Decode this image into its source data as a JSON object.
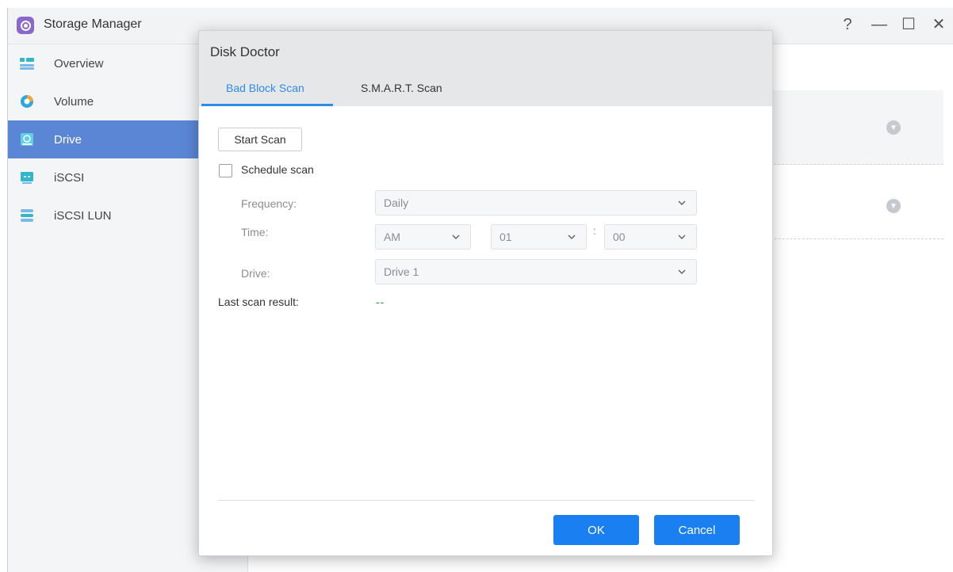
{
  "app": {
    "title": "Storage Manager",
    "window_controls": {
      "help": "?",
      "minimize": "—",
      "maximize": "☐",
      "close": "✕"
    }
  },
  "sidebar": {
    "items": [
      {
        "label": "Overview",
        "icon": "overview-icon",
        "active": false
      },
      {
        "label": "Volume",
        "icon": "volume-icon",
        "active": false
      },
      {
        "label": "Drive",
        "icon": "drive-icon",
        "active": true
      },
      {
        "label": "iSCSI",
        "icon": "iscsi-icon",
        "active": false
      },
      {
        "label": "iSCSI LUN",
        "icon": "iscsi-lun-icon",
        "active": false
      }
    ]
  },
  "modal": {
    "title": "Disk Doctor",
    "tabs": [
      {
        "label": "Bad Block Scan",
        "active": true
      },
      {
        "label": "S.M.A.R.T. Scan",
        "active": false
      }
    ],
    "start_scan_label": "Start Scan",
    "schedule_scan": {
      "label": "Schedule scan",
      "checked": false
    },
    "frequency": {
      "label": "Frequency:",
      "value": "Daily"
    },
    "time": {
      "label": "Time:",
      "ampm": "AM",
      "hour": "01",
      "separator": ":",
      "minute": "00"
    },
    "drive": {
      "label": "Drive:",
      "value": "Drive 1"
    },
    "last_scan": {
      "label": "Last scan result:",
      "value": "--"
    },
    "ok_label": "OK",
    "cancel_label": "Cancel"
  },
  "colors": {
    "accent": "#2f8bea",
    "primary_button": "#1a7ff0",
    "sidebar_active": "#5b86d6",
    "result_green": "#2a9b3c"
  }
}
